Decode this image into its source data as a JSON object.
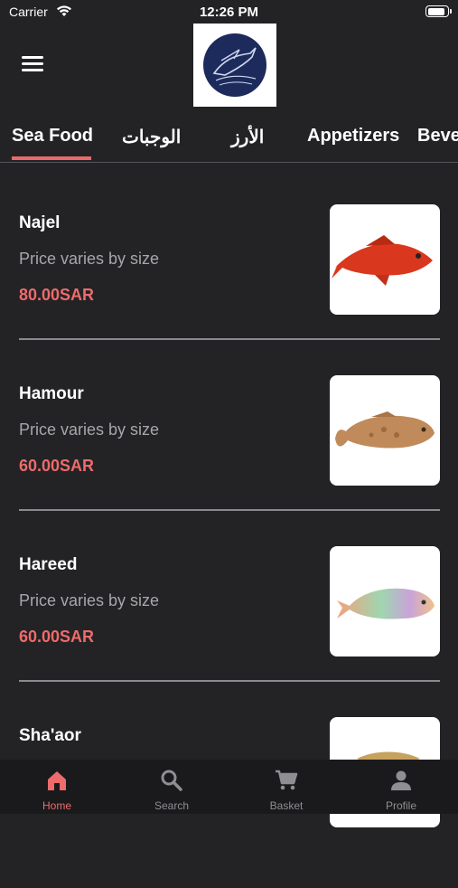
{
  "status": {
    "carrier": "Carrier",
    "time": "12:26 PM",
    "battery_level": 0.9
  },
  "header": {
    "logo": "restaurant-logo"
  },
  "tabs": [
    "Sea Food",
    "الوجبات",
    "الأرز",
    "Appetizers",
    "Beve"
  ],
  "active_tab": 0,
  "items": [
    {
      "name": "Najel",
      "desc": "Price varies by size",
      "price": "80.00SAR",
      "image": "red-fish"
    },
    {
      "name": "Hamour",
      "desc": "Price varies by size",
      "price": "60.00SAR",
      "image": "grouper-fish"
    },
    {
      "name": "Hareed",
      "desc": "Price varies by size",
      "price": "60.00SAR",
      "image": "parrot-fish"
    },
    {
      "name": "Sha'aor",
      "desc": "",
      "price": "",
      "image": "fish"
    }
  ],
  "bottom_nav": [
    {
      "label": "Home",
      "icon": "home-icon",
      "active": true
    },
    {
      "label": "Search",
      "icon": "search-icon",
      "active": false
    },
    {
      "label": "Basket",
      "icon": "cart-icon",
      "active": false
    },
    {
      "label": "Profile",
      "icon": "person-icon",
      "active": false
    }
  ],
  "colors": {
    "accent": "#ee6b6b",
    "background": "#232326",
    "tabbar": "#1a1a1c",
    "logo_disc": "#1d2a5c"
  }
}
